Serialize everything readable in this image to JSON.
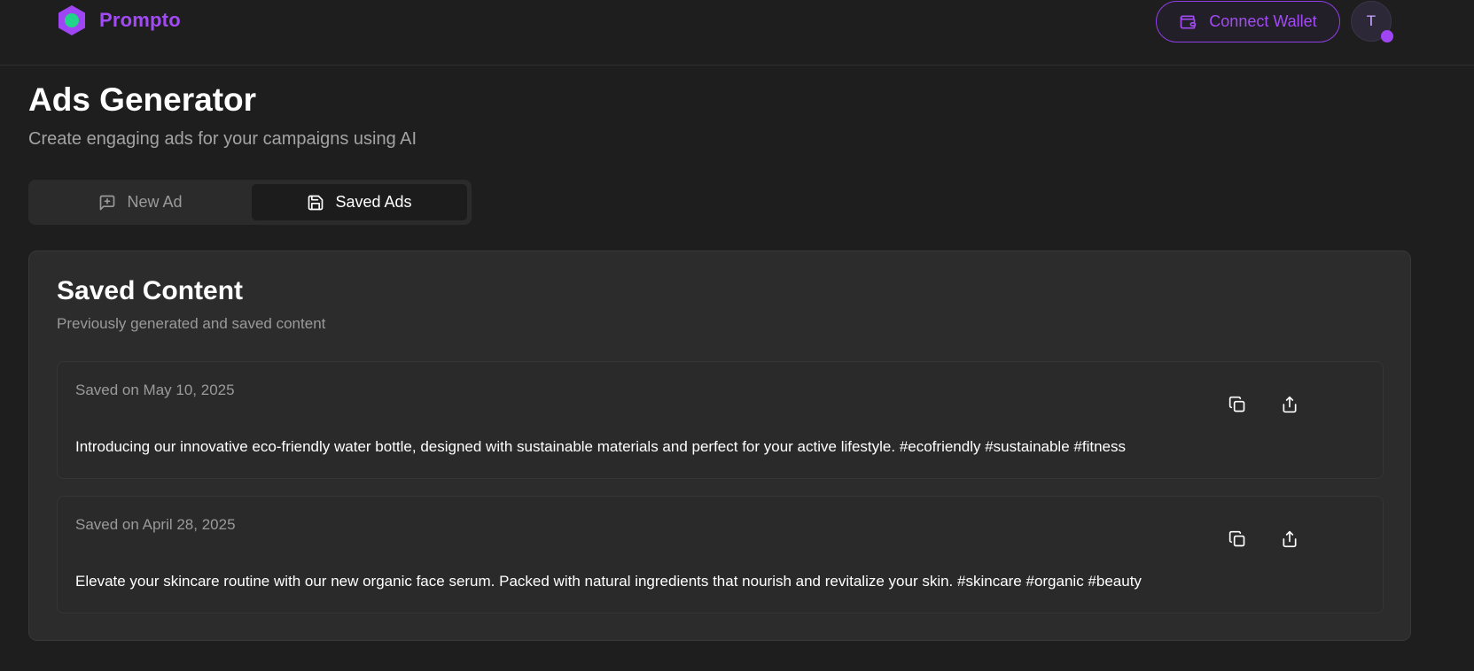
{
  "brand": {
    "name": "Prompto",
    "accent_color": "#a24bf5",
    "logo_inner_color": "#22d38a"
  },
  "header": {
    "connect_wallet_label": "Connect Wallet",
    "avatar_initial": "T"
  },
  "page": {
    "title": "Ads Generator",
    "subtitle": "Create engaging ads for your campaigns using AI"
  },
  "tabs": [
    {
      "label": "New Ad",
      "icon": "message-plus-icon",
      "active": false
    },
    {
      "label": "Saved Ads",
      "icon": "save-icon",
      "active": true
    }
  ],
  "saved": {
    "title": "Saved Content",
    "description": "Previously generated and saved content",
    "items": [
      {
        "date": "Saved on May 10, 2025",
        "text": "Introducing our innovative eco-friendly water bottle, designed with sustainable materials and perfect for your active lifestyle. #ecofriendly #sustainable #fitness"
      },
      {
        "date": "Saved on April 28, 2025",
        "text": "Elevate your skincare routine with our new organic face serum. Packed with natural ingredients that nourish and revitalize your skin. #skincare #organic #beauty"
      }
    ]
  }
}
